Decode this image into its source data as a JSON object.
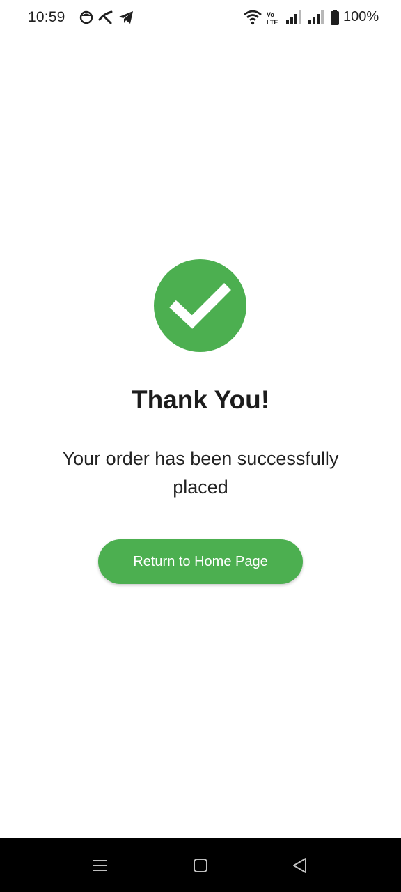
{
  "status_bar": {
    "time": "10:59",
    "battery": "100%",
    "icons": [
      "face-icon",
      "telenor-icon",
      "telegram-icon",
      "wifi-icon",
      "volte-icon",
      "signal-icon",
      "signal-icon",
      "battery-icon"
    ]
  },
  "main": {
    "icon": "check-circle-icon",
    "title": "Thank You!",
    "message": "Your order has been successfully placed",
    "button_label": "Return to Home Page"
  },
  "nav_bar": {
    "buttons": [
      "menu-icon",
      "home-icon",
      "back-icon"
    ]
  },
  "colors": {
    "accent": "#4caf50",
    "text": "#1c1c1c",
    "nav_background": "#000000"
  }
}
